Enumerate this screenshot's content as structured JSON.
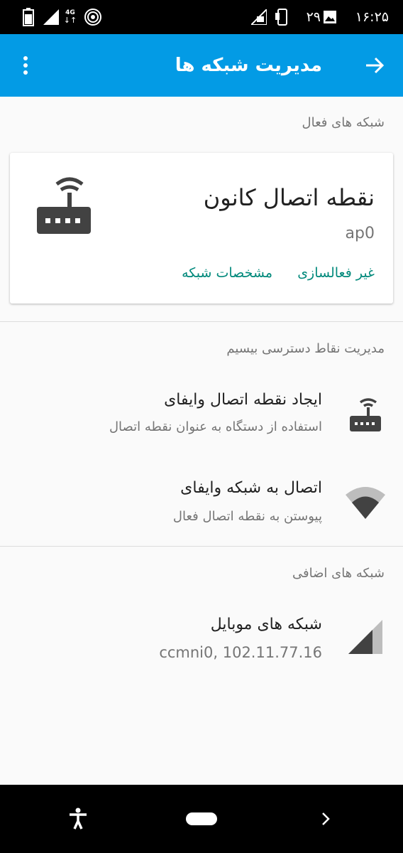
{
  "status_bar": {
    "clock": "۱۶:۲۵",
    "notification_count": "۲۹",
    "network_type": "4G",
    "icons": [
      "battery-icon",
      "signal-icon",
      "hotspot-icon",
      "sim-icon",
      "phone-icon",
      "image-icon"
    ]
  },
  "app_bar": {
    "title": "مدیریت شبکه ها",
    "color": "#039be5",
    "icons": [
      "back-arrow-icon",
      "more-vert-icon"
    ]
  },
  "active_section": {
    "header": "شبکه های فعال",
    "card": {
      "title": "نقطه اتصال کانون",
      "subtitle": "ap0",
      "action_deactivate": "غیر فعالسازی",
      "action_details": "مشخصات شبکه",
      "icon": "router-icon",
      "action_color": "#00897b"
    }
  },
  "wireless_section": {
    "header": "مدیریت نقاط دسترسی بیسیم",
    "items": [
      {
        "title": "ایجاد نقطه اتصال وایفای",
        "subtitle": "استفاده از دستگاه به عنوان نقطه اتصال",
        "icon": "router-icon"
      },
      {
        "title": "اتصال به شبکه وایفای",
        "subtitle": "پیوستن به نقطه اتصال فعال",
        "icon": "wifi-icon"
      }
    ]
  },
  "extra_section": {
    "header": "شبکه های اضافی",
    "items": [
      {
        "title": "شبکه های موبایل",
        "subtitle": "ccmni0, 102.11.77.16",
        "icon": "cellular-signal-icon"
      }
    ]
  },
  "nav_bar": {
    "icons": [
      "accessibility-icon",
      "home-pill-icon",
      "chevron-icon"
    ]
  }
}
